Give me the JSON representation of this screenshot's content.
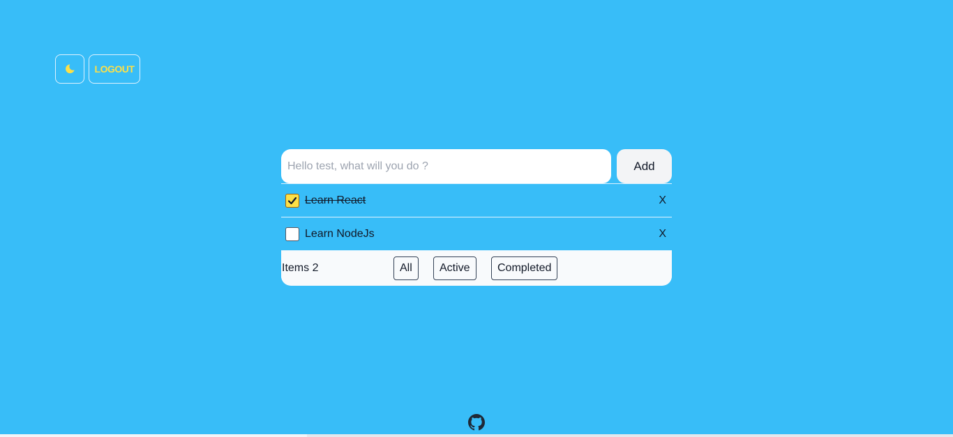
{
  "header": {
    "theme_icon": "moon-icon",
    "logout_label": "LOGOUT"
  },
  "colors": {
    "background": "#38bdf8",
    "accent": "#fde047",
    "card": "#f8fafc"
  },
  "todo": {
    "input_placeholder": "Hello test, what will you do ?",
    "input_value": "",
    "add_label": "Add",
    "items": [
      {
        "text": "Learn React",
        "completed": true,
        "delete_label": "X"
      },
      {
        "text": "Learn NodeJs",
        "completed": false,
        "delete_label": "X"
      }
    ],
    "footer": {
      "items_count": "Items 2",
      "filters": [
        "All",
        "Active",
        "Completed"
      ]
    }
  },
  "footer": {
    "github_icon": "github-icon"
  }
}
